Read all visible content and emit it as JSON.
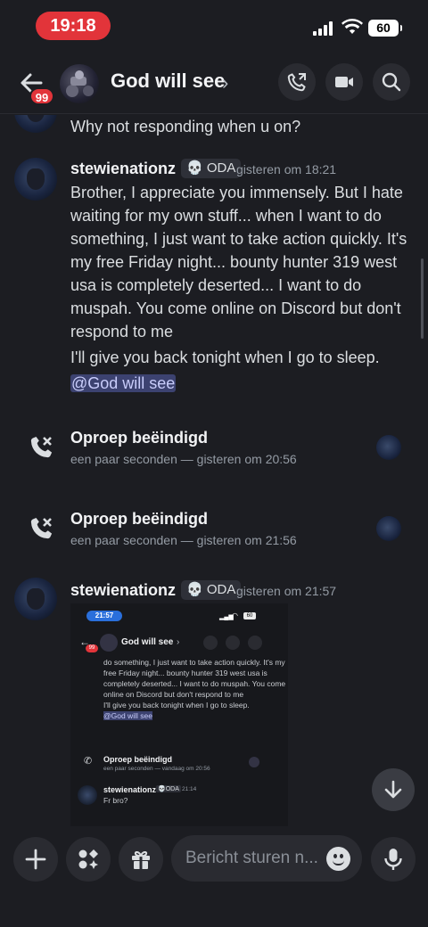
{
  "status_bar": {
    "time": "19:18",
    "battery": "60"
  },
  "header": {
    "badge": "99",
    "title": "God will see",
    "chevron": "›"
  },
  "messages": {
    "prev_text": "Why not responding when u on?",
    "msg1": {
      "author": "stewienationz",
      "tag": "ODA",
      "timestamp": "gisteren om 18:21",
      "line1": "Brother, I appreciate you immensely. But I hate waiting for my own stuff... when I want to do something, I just want to take action quickly. It's my free Friday night... bounty hunter 319 west usa is completely deserted... I want to do muspah. You come online on Discord but don't respond to me",
      "line2": "I'll give you back tonight when I go to sleep.",
      "mention": "@God will see"
    },
    "call1": {
      "title": "Oproep beëindigd",
      "sub": "een paar seconden — gisteren om 20:56"
    },
    "call2": {
      "title": "Oproep beëindigd",
      "sub": "een paar seconden — gisteren om 21:56"
    },
    "msg2": {
      "author": "stewienationz",
      "tag": "ODA",
      "timestamp": "gisteren om 21:57",
      "attachment": {
        "time": "21:57",
        "battery": "60",
        "title": "God will see",
        "chevron": "›",
        "badge": "99",
        "text": "do something, I just want to take action quickly. It's my free Friday night... bounty hunter 319 west usa is completely deserted... I want to do muspah. You come online on Discord but don't respond to me",
        "text2": "I'll give you back tonight when I go to sleep.",
        "mention": "@God will see",
        "call_title": "Oproep beëindigd",
        "call_sub": "een paar seconden — vandaag om 20:56",
        "author": "stewienationz",
        "tag": "ODA",
        "timestamp": "21:14",
        "message": "Fr bro?"
      }
    }
  },
  "composer": {
    "placeholder": "Bericht sturen n..."
  },
  "colors": {
    "background": "#1c1d22",
    "accent_red": "#e2343a",
    "mention_bg": "#3c4270",
    "button_bg": "#2a2b31"
  },
  "icons": [
    "back-arrow-icon",
    "phone-icon",
    "video-icon",
    "search-icon",
    "call-ended-icon",
    "arrow-down-icon",
    "plus-icon",
    "apps-icon",
    "gift-icon",
    "emoji-icon",
    "microphone-icon",
    "skull-icon"
  ]
}
